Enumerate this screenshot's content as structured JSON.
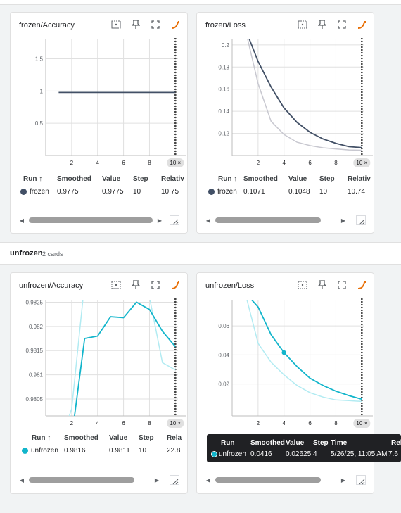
{
  "colors": {
    "frozen": "#425066",
    "unfrozen": "#12b5cb",
    "unfrozen_light": "#b2ebf2",
    "frozen_light": "#c8c8d0",
    "grid": "#e0e0e0",
    "card": "#ffffff"
  },
  "icons": [
    "fit-domain-icon",
    "pin-icon",
    "fullscreen-icon",
    "smoothing-icon"
  ],
  "section": {
    "name": "unfrozen",
    "count": "2 cards"
  },
  "headers": {
    "run": "Run ↑",
    "smoothed": "Smoothed",
    "value": "Value",
    "step": "Step",
    "relative": "Relativ",
    "relative_short": "Rela"
  },
  "cards": [
    {
      "title": "frozen/Accuracy",
      "run": "frozen",
      "smoothed": "0.9775",
      "value": "0.9775",
      "step": "10",
      "relative": "10.75",
      "yticks": [
        "1.5",
        "1",
        "0.5"
      ],
      "xticks": [
        "2",
        "4",
        "6",
        "8",
        "10"
      ],
      "x_badge": "10 ×"
    },
    {
      "title": "frozen/Loss",
      "run": "frozen",
      "smoothed": "0.1071",
      "value": "0.1048",
      "step": "10",
      "relative": "10.74",
      "yticks": [
        "0.2",
        "0.18",
        "0.16",
        "0.14",
        "0.12"
      ],
      "xticks": [
        "2",
        "4",
        "6",
        "8",
        "10"
      ],
      "x_badge": "10 ×"
    },
    {
      "title": "unfrozen/Accuracy",
      "run": "unfrozen",
      "smoothed": "0.9816",
      "value": "0.9811",
      "step": "10",
      "relative": "22.8",
      "yticks": [
        "0.9825",
        "0.982",
        "0.9815",
        "0.981",
        "0.9805"
      ],
      "xticks": [
        "2",
        "4",
        "6",
        "8",
        "10"
      ],
      "x_badge": "10 ×"
    },
    {
      "title": "unfrozen/Loss",
      "run": "unfrozen",
      "yticks": [
        "0.06",
        "0.04",
        "0.02"
      ],
      "xticks": [
        "2",
        "4",
        "6",
        "8",
        "10"
      ],
      "x_badge": "10 ×"
    }
  ],
  "tooltip": {
    "headers": {
      "run": "Run",
      "smoothed": "Smoothed",
      "value": "Value",
      "step": "Step",
      "time": "Time",
      "relative": "Rel"
    },
    "run": "unfrozen",
    "smoothed": "0.0416",
    "value": "0.02625",
    "step": "4",
    "time": "5/26/25, 11:05 AM",
    "relative": "7.6"
  },
  "chart_data": [
    {
      "type": "line",
      "title": "frozen/Accuracy",
      "x": [
        1,
        2,
        3,
        4,
        5,
        6,
        7,
        8,
        9,
        10
      ],
      "series": [
        {
          "name": "frozen",
          "values": [
            0.9775,
            0.9775,
            0.9775,
            0.9775,
            0.9775,
            0.9775,
            0.9775,
            0.9775,
            0.9775,
            0.9775
          ]
        }
      ],
      "xlim": [
        0,
        10.2
      ],
      "ylim": [
        0,
        1.8
      ]
    },
    {
      "type": "line",
      "title": "frozen/Loss",
      "x": [
        1,
        2,
        3,
        4,
        5,
        6,
        7,
        8,
        9,
        10
      ],
      "series": [
        {
          "name": "frozen",
          "smoothed": [
            0.215,
            0.185,
            0.162,
            0.143,
            0.13,
            0.121,
            0.115,
            0.111,
            0.108,
            0.1071
          ],
          "values": [
            0.215,
            0.165,
            0.131,
            0.119,
            0.112,
            0.109,
            0.107,
            0.106,
            0.105,
            0.1048
          ]
        }
      ],
      "xlim": [
        0,
        10.2
      ],
      "ylim": [
        0.1,
        0.205
      ]
    },
    {
      "type": "line",
      "title": "unfrozen/Accuracy",
      "x": [
        1,
        2,
        3,
        4,
        5,
        6,
        7,
        8,
        9,
        10
      ],
      "series": [
        {
          "name": "unfrozen",
          "smoothed": [
            0.9795,
            0.9797,
            0.98175,
            0.9818,
            0.9822,
            0.98218,
            0.9825,
            0.98235,
            0.9819,
            0.98158
          ],
          "values": [
            0.9795,
            0.9803,
            0.9829,
            0.9826,
            0.983,
            0.9828,
            0.983,
            0.9826,
            0.98125,
            0.9811
          ]
        }
      ],
      "xlim": [
        0,
        10.2
      ],
      "ylim": [
        0.98015,
        0.98255
      ]
    },
    {
      "type": "line",
      "title": "unfrozen/Loss",
      "x": [
        1,
        2,
        3,
        4,
        5,
        6,
        7,
        8,
        9,
        10
      ],
      "series": [
        {
          "name": "unfrozen",
          "smoothed": [
            0.083,
            0.073,
            0.054,
            0.0416,
            0.032,
            0.024,
            0.019,
            0.015,
            0.012,
            0.0095
          ],
          "values": [
            0.083,
            0.048,
            0.035,
            0.02625,
            0.019,
            0.014,
            0.011,
            0.009,
            0.0085,
            0.008
          ]
        }
      ],
      "xlim": [
        0,
        10.2
      ],
      "ylim": [
        -0.002,
        0.078
      ]
    }
  ]
}
